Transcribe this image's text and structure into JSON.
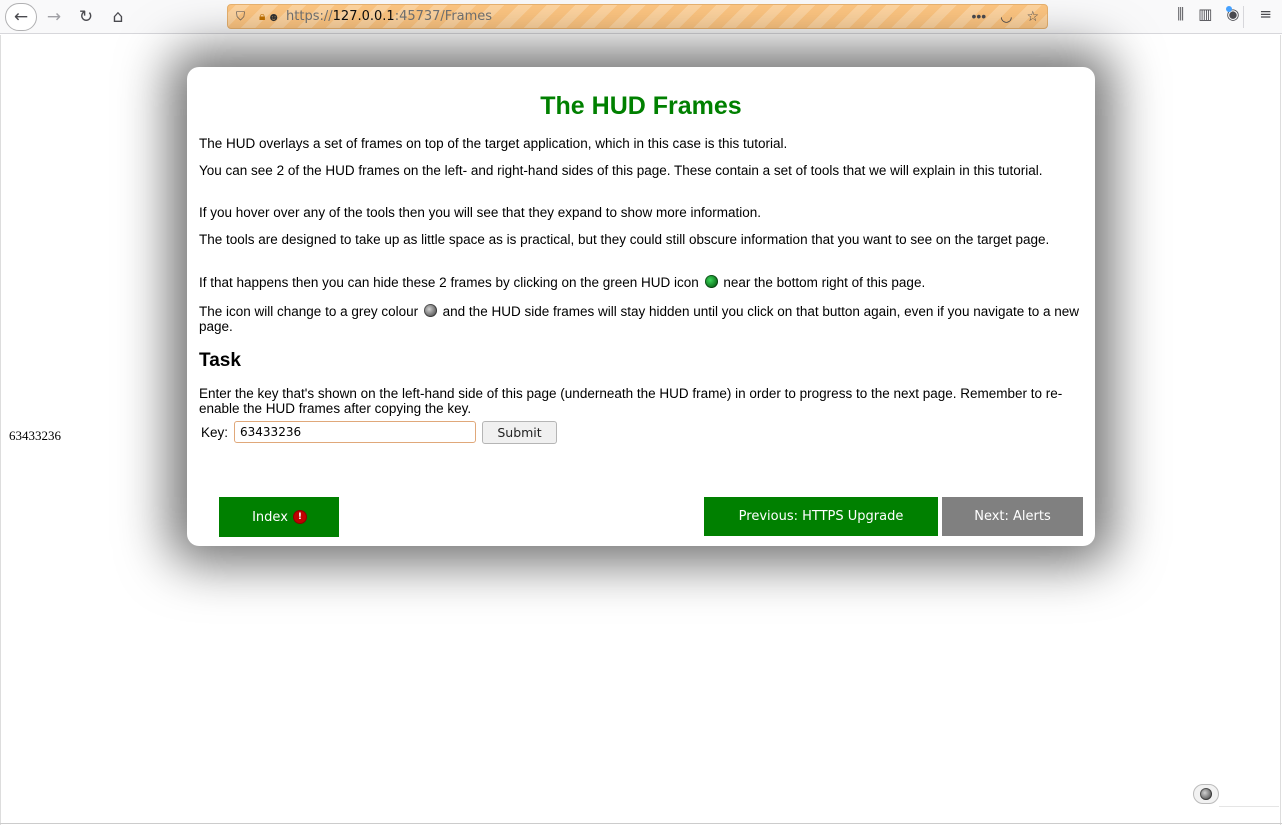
{
  "browser": {
    "url_scheme": "https://",
    "url_host": "127.0.0.1",
    "url_rest": ":45737/Frames"
  },
  "page": {
    "left_key": "63433236"
  },
  "modal": {
    "title": "The HUD Frames",
    "paragraphs": [
      "The HUD overlays a set of frames on top of the target application, which in this case is this tutorial.",
      "You can see 2 of the HUD frames on the left- and right-hand sides of this page. These contain a set of tools that we will explain in this tutorial.",
      "If you hover over any of the tools then you will see that they expand to show more information.",
      "The tools are designed to take up as little space as is practical, but they could still obscure information that you want to see on the target page."
    ],
    "para_green_before": "If that happens then you can hide these 2 frames by clicking on the green HUD icon",
    "para_green_after": "near the bottom right of this page.",
    "para_grey_before": "The icon will change to a grey colour",
    "para_grey_after": "and the HUD side frames will stay hidden until you click on that button again, even if you navigate to a new page.",
    "task_heading": "Task",
    "task_text": "Enter the key that's shown on the left-hand side of this page (underneath the HUD frame) in order to progress to the next page. Remember to re-enable the HUD frames after copying the key.",
    "key_label": "Key:",
    "key_value": "63433236",
    "submit_label": "Submit",
    "index_label": "Index",
    "index_badge": "!",
    "prev_label": "Previous: HTTPS Upgrade",
    "next_label": "Next: Alerts"
  },
  "colors": {
    "green": "#008000",
    "grey": "#808080",
    "alert_red": "#c00000"
  },
  "icons": [
    "back-arrow-icon",
    "forward-arrow-icon",
    "reload-icon",
    "home-icon",
    "shield-icon",
    "lock-icon",
    "robot-icon",
    "more-icon",
    "pocket-icon",
    "bookmark-star-icon",
    "library-icon",
    "sidebar-icon",
    "account-icon",
    "menu-icon",
    "hud-icon"
  ]
}
